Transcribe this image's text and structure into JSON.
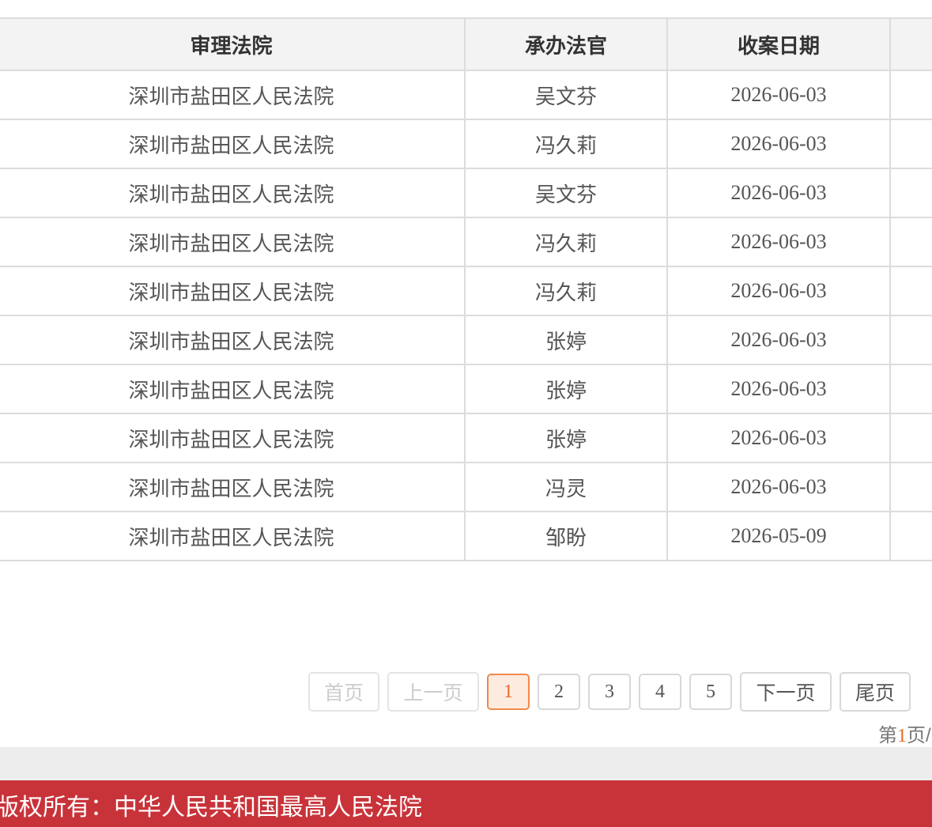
{
  "table": {
    "headers": [
      "审理法院",
      "承办法官",
      "收案日期"
    ],
    "rows": [
      {
        "court": "深圳市盐田区人民法院",
        "judge": "吴文芬",
        "date": "2026-06-03"
      },
      {
        "court": "深圳市盐田区人民法院",
        "judge": "冯久莉",
        "date": "2026-06-03"
      },
      {
        "court": "深圳市盐田区人民法院",
        "judge": "吴文芬",
        "date": "2026-06-03"
      },
      {
        "court": "深圳市盐田区人民法院",
        "judge": "冯久莉",
        "date": "2026-06-03"
      },
      {
        "court": "深圳市盐田区人民法院",
        "judge": "冯久莉",
        "date": "2026-06-03"
      },
      {
        "court": "深圳市盐田区人民法院",
        "judge": "张婷",
        "date": "2026-06-03"
      },
      {
        "court": "深圳市盐田区人民法院",
        "judge": "张婷",
        "date": "2026-06-03"
      },
      {
        "court": "深圳市盐田区人民法院",
        "judge": "张婷",
        "date": "2026-06-03"
      },
      {
        "court": "深圳市盐田区人民法院",
        "judge": "冯灵",
        "date": "2026-06-03"
      },
      {
        "court": "深圳市盐田区人民法院",
        "judge": "邹盼",
        "date": "2026-05-09"
      }
    ]
  },
  "pagination": {
    "first_label": "首页",
    "prev_label": "上一页",
    "pages": [
      "1",
      "2",
      "3",
      "4",
      "5"
    ],
    "current_page": "1",
    "next_label": "下一页",
    "last_label": "尾页",
    "info_prefix": "第",
    "info_current": "1",
    "info_suffix": "页/"
  },
  "footer": {
    "text": "版权所有：中华人民共和国最高人民法院"
  },
  "colors": {
    "footer_bg": "#c8333a",
    "active_page": "#e86a22",
    "header_bg": "#f3f3f3"
  }
}
